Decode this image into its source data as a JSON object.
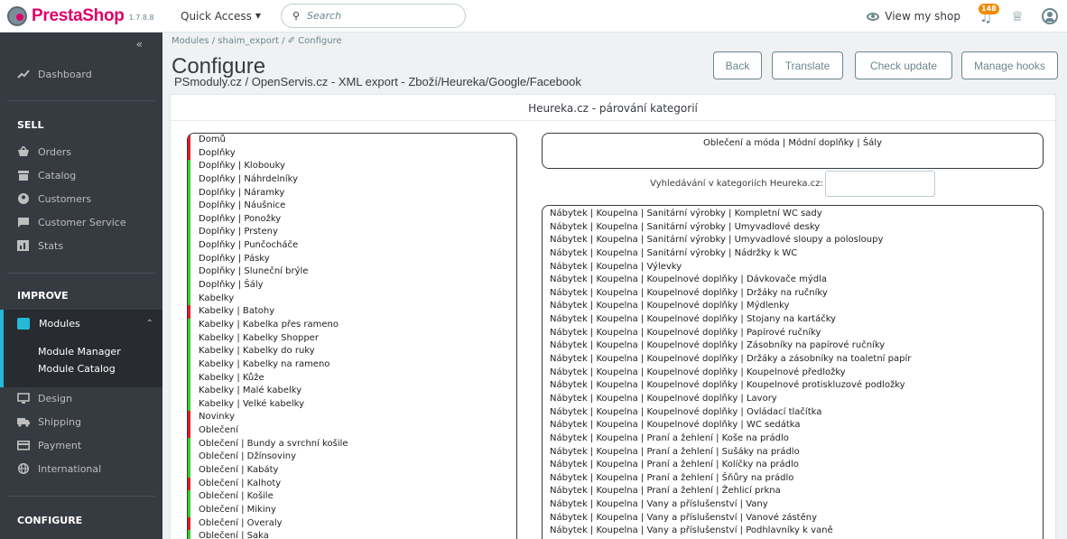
{
  "header": {
    "brand": "PrestaShop",
    "version": "1.7.8.8",
    "quick_access": "Quick Access",
    "search_placeholder": "Search",
    "view_shop": "View my shop",
    "notifications_count": "148"
  },
  "sidebar": {
    "collapse_glyph": "«",
    "dashboard": "Dashboard",
    "sell_heading": "SELL",
    "sell_items": [
      "Orders",
      "Catalog",
      "Customers",
      "Customer Service",
      "Stats"
    ],
    "improve_heading": "IMPROVE",
    "modules": "Modules",
    "module_subitems": [
      "Module Manager",
      "Module Catalog"
    ],
    "improve_items": [
      "Design",
      "Shipping",
      "Payment",
      "International"
    ],
    "configure_heading": "CONFIGURE",
    "accent_color": "#25b9d7"
  },
  "page": {
    "breadcrumb": "Modules  /  shaim_export  /  ✐ Configure",
    "title": "Configure",
    "subtitle": "PSmoduly.cz / OpenServis.cz - XML export - Zboží/Heureka/Google/Facebook",
    "buttons": {
      "back": "Back",
      "translate": "Translate",
      "check_update": "Check update",
      "manage_hooks": "Manage hooks"
    }
  },
  "panel": {
    "title": "Heureka.cz - párování kategorií",
    "selected_category": "Oblečení a móda | Módní doplňky | Šály",
    "search_label": "Vyhledávání v kategoriích Heureka.cz:",
    "search_value": "",
    "shop_categories": [
      {
        "label": "Domů",
        "status": "red"
      },
      {
        "label": "Doplňky",
        "status": "red"
      },
      {
        "label": "Doplňky | Klobouky",
        "status": "green"
      },
      {
        "label": "Doplňky | Náhrdelníky",
        "status": "green"
      },
      {
        "label": "Doplňky | Náramky",
        "status": "green"
      },
      {
        "label": "Doplňky | Náušnice",
        "status": "green"
      },
      {
        "label": "Doplňky | Ponožky",
        "status": "green"
      },
      {
        "label": "Doplňky | Prsteny",
        "status": "green"
      },
      {
        "label": "Doplňky | Punčocháče",
        "status": "green"
      },
      {
        "label": "Doplňky | Pásky",
        "status": "green"
      },
      {
        "label": "Doplňky | Sluneční brýle",
        "status": "green"
      },
      {
        "label": "Doplňky | Šály",
        "status": "green"
      },
      {
        "label": "Kabelky",
        "status": "green"
      },
      {
        "label": "Kabelky | Batohy",
        "status": "red"
      },
      {
        "label": "Kabelky | Kabelka přes rameno",
        "status": "green"
      },
      {
        "label": "Kabelky | Kabelky Shopper",
        "status": "green"
      },
      {
        "label": "Kabelky | Kabelky do ruky",
        "status": "green"
      },
      {
        "label": "Kabelky | Kabelky na rameno",
        "status": "green"
      },
      {
        "label": "Kabelky | Kůže",
        "status": "green"
      },
      {
        "label": "Kabelky | Malé kabelky",
        "status": "green"
      },
      {
        "label": "Kabelky | Velké kabelky",
        "status": "green"
      },
      {
        "label": "Novinky",
        "status": "red"
      },
      {
        "label": "Oblečení",
        "status": "red"
      },
      {
        "label": "Oblečení | Bundy a svrchní košile",
        "status": "green"
      },
      {
        "label": "Oblečení | Džínsoviny",
        "status": "green"
      },
      {
        "label": "Oblečení | Kabáty",
        "status": "green"
      },
      {
        "label": "Oblečení | Kalhoty",
        "status": "red"
      },
      {
        "label": "Oblečení | Košile",
        "status": "green"
      },
      {
        "label": "Oblečení | Mikiny",
        "status": "green"
      },
      {
        "label": "Oblečení | Overaly",
        "status": "red"
      },
      {
        "label": "Oblečení | Saka",
        "status": "green"
      }
    ],
    "heureka_categories": [
      "Nábytek | Koupelna | Sanitární výrobky | Kompletní WC sady",
      "Nábytek | Koupelna | Sanitární výrobky | Umyvadlové desky",
      "Nábytek | Koupelna | Sanitární výrobky | Umyvadlové sloupy a polosloupy",
      "Nábytek | Koupelna | Sanitární výrobky | Nádržky k WC",
      "Nábytek | Koupelna | Výlevky",
      "Nábytek | Koupelna | Koupelnové doplňky | Dávkovače mýdla",
      "Nábytek | Koupelna | Koupelnové doplňky | Držáky na ručníky",
      "Nábytek | Koupelna | Koupelnové doplňky | Mýdlenky",
      "Nábytek | Koupelna | Koupelnové doplňky | Stojany na kartáčky",
      "Nábytek | Koupelna | Koupelnové doplňky | Papírové ručníky",
      "Nábytek | Koupelna | Koupelnové doplňky | Zásobníky na papírové ručníky",
      "Nábytek | Koupelna | Koupelnové doplňky | Držáky a zásobníky na toaletní papír",
      "Nábytek | Koupelna | Koupelnové doplňky | Koupelnové předložky",
      "Nábytek | Koupelna | Koupelnové doplňky | Koupelnové protiskluzové podložky",
      "Nábytek | Koupelna | Koupelnové doplňky | Lavory",
      "Nábytek | Koupelna | Koupelnové doplňky | Ovládací tlačítka",
      "Nábytek | Koupelna | Koupelnové doplňky | WC sedátka",
      "Nábytek | Koupelna | Praní a žehlení | Koše na prádlo",
      "Nábytek | Koupelna | Praní a žehlení | Sušáky na prádlo",
      "Nábytek | Koupelna | Praní a žehlení | Kolíčky na prádlo",
      "Nábytek | Koupelna | Praní a žehlení | Šňůry na prádlo",
      "Nábytek | Koupelna | Praní a žehlení | Žehlicí prkna",
      "Nábytek | Koupelna | Vany a příslušenství | Vany",
      "Nábytek | Koupelna | Vany a příslušenství | Vanové zástěny",
      "Nábytek | Koupelna | Vany a příslušenství | Podhlavníky k vaně"
    ]
  }
}
